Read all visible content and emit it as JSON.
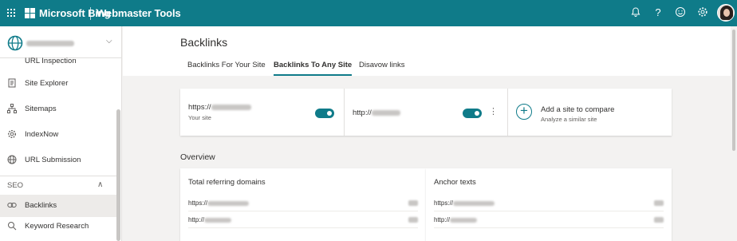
{
  "topbar": {
    "brand": "Microsoft Bing",
    "product": "Webmaster Tools",
    "icons": [
      "waffle-icon",
      "bell-icon",
      "help-icon",
      "feedback-icon",
      "settings-icon",
      "avatar"
    ]
  },
  "sidebar": {
    "site_picker_icon": "globe-icon",
    "items": [
      {
        "label": "URL Inspection",
        "icon": "inspect-icon"
      },
      {
        "label": "Site Explorer",
        "icon": "document-icon"
      },
      {
        "label": "Sitemaps",
        "icon": "sitemap-icon"
      },
      {
        "label": "IndexNow",
        "icon": "gear-icon"
      },
      {
        "label": "URL Submission",
        "icon": "globe-icon"
      }
    ],
    "seo_section": "SEO",
    "seo_items": [
      {
        "label": "Backlinks",
        "icon": "link-icon",
        "active": true
      },
      {
        "label": "Keyword Research",
        "icon": "search-icon"
      }
    ]
  },
  "main": {
    "title": "Backlinks",
    "tabs": [
      {
        "label": "Backlinks For Your Site",
        "active": false
      },
      {
        "label": "Backlinks To Any Site",
        "active": true
      },
      {
        "label": "Disavow links",
        "active": false
      }
    ],
    "compare": {
      "site1_prefix": "https://",
      "site1_sub": "Your site",
      "site2_prefix": "http://",
      "add_title": "Add a site to compare",
      "add_sub": "Analyze a similar site"
    },
    "overview": {
      "title": "Overview",
      "cards": [
        {
          "title": "Total referring domains",
          "rows": [
            {
              "prefix": "https://"
            },
            {
              "prefix": "http://"
            }
          ]
        },
        {
          "title": "Anchor texts",
          "rows": [
            {
              "prefix": "https://"
            },
            {
              "prefix": "http://"
            }
          ]
        }
      ]
    }
  },
  "colors": {
    "accent": "#0f7b89",
    "background": "#f3f2f1"
  }
}
